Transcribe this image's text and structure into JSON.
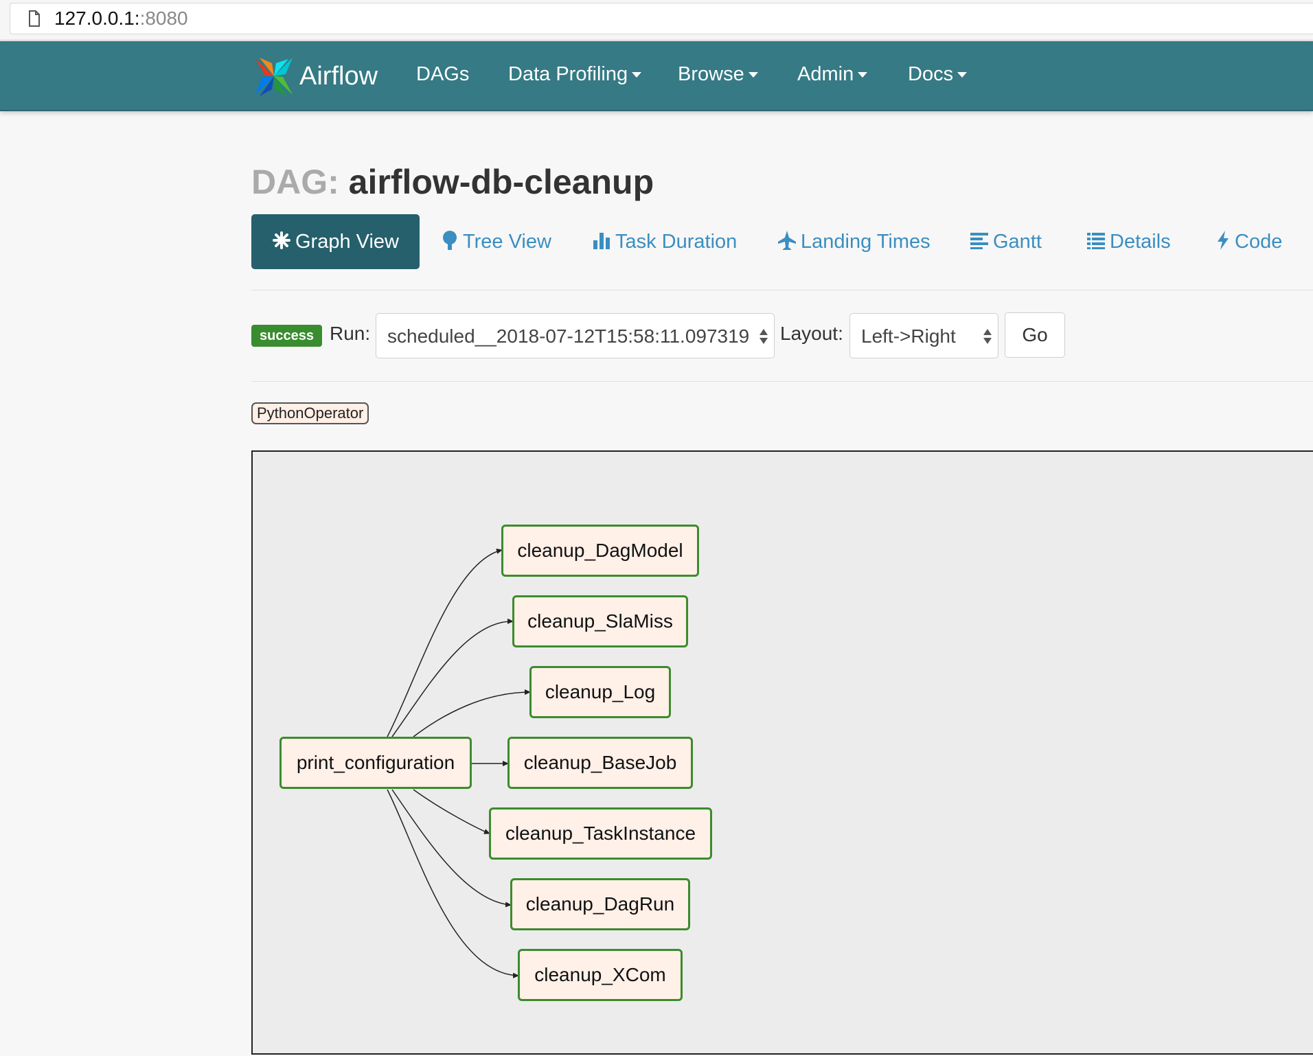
{
  "browser": {
    "url_host": "127.0.0.1:",
    "url_port": ":8080"
  },
  "navbar": {
    "brand": "Airflow",
    "items": [
      {
        "label": "DAGs",
        "has_caret": false
      },
      {
        "label": "Data Profiling",
        "has_caret": true
      },
      {
        "label": "Browse",
        "has_caret": true
      },
      {
        "label": "Admin",
        "has_caret": true
      },
      {
        "label": "Docs",
        "has_caret": true
      }
    ]
  },
  "page": {
    "title_prefix": "DAG:",
    "title_name": "airflow-db-cleanup"
  },
  "tabs": [
    {
      "label": "Graph View",
      "icon": "asterisk-icon",
      "active": true
    },
    {
      "label": "Tree View",
      "icon": "tree-icon",
      "active": false
    },
    {
      "label": "Task Duration",
      "icon": "bar-chart-icon",
      "active": false
    },
    {
      "label": "Landing Times",
      "icon": "plane-icon",
      "active": false
    },
    {
      "label": "Gantt",
      "icon": "align-left-icon",
      "active": false
    },
    {
      "label": "Details",
      "icon": "list-icon",
      "active": false
    },
    {
      "label": "Code",
      "icon": "bolt-icon",
      "active": false
    }
  ],
  "run_bar": {
    "status": "success",
    "run_label": "Run:",
    "run_value": "scheduled__2018-07-12T15:58:11.097319",
    "layout_label": "Layout:",
    "layout_value": "Left->Right",
    "go_label": "Go"
  },
  "legend": {
    "operator": "PythonOperator"
  },
  "graph": {
    "source": "print_configuration",
    "targets": [
      "cleanup_DagModel",
      "cleanup_SlaMiss",
      "cleanup_Log",
      "cleanup_BaseJob",
      "cleanup_TaskInstance",
      "cleanup_DagRun",
      "cleanup_XCom"
    ]
  },
  "colors": {
    "navbar": "#357a84",
    "active_tab": "#25606c",
    "link": "#3a8ec1",
    "success": "#3a8d2f",
    "node_border": "#3c8b2c",
    "node_fill": "#fff0e8"
  }
}
